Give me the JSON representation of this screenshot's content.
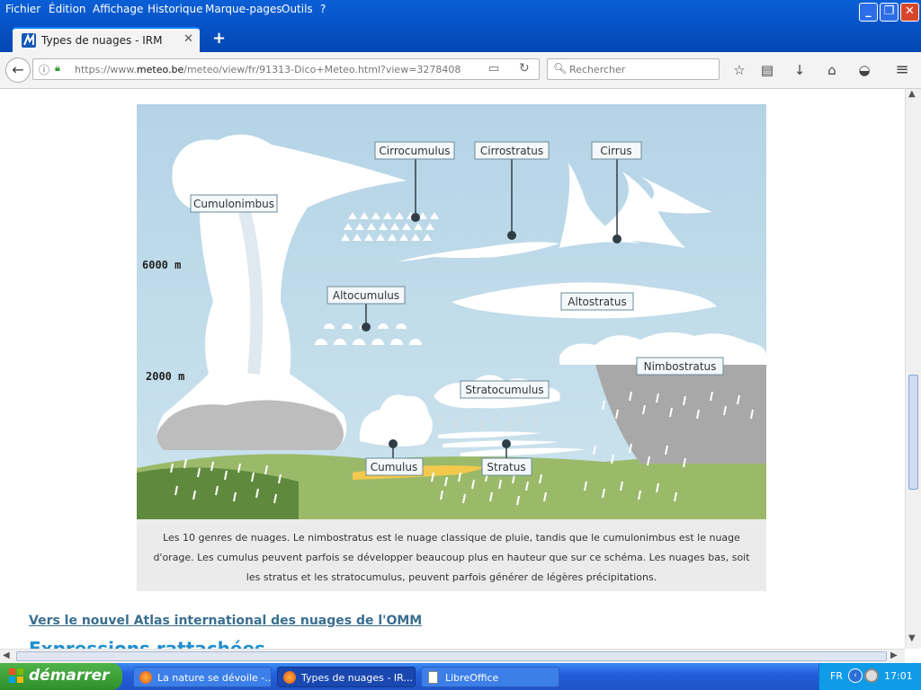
{
  "menubar": {
    "items": [
      "Fichier",
      "Édition",
      "Affichage",
      "Historique",
      "Marque-pages",
      "Outils",
      "?"
    ]
  },
  "tab": {
    "title": "Types de nuages - IRM"
  },
  "navbar": {
    "url_prefix": "https://www.",
    "url_domain": "meteo.be",
    "url_path": "/meteo/view/fr/91313-Dico+Meteo.html?view=3278408",
    "search_placeholder": "Rechercher"
  },
  "figure": {
    "labels": {
      "cirrocumulus": "Cirrocumulus",
      "cirrostratus": "Cirrostratus",
      "cirrus": "Cirrus",
      "cumulonimbus": "Cumulonimbus",
      "altocumulus": "Altocumulus",
      "altostratus": "Altostratus",
      "nimbostratus": "Nimbostratus",
      "stratocumulus": "Stratocumulus",
      "cumulus": "Cumulus",
      "stratus": "Stratus",
      "alt_6000": "6000 m",
      "alt_2000": "2000 m"
    },
    "caption_lines": [
      "Les 10 genres de nuages. Le nimbostratus est le nuage classique de pluie, tandis que le cumulonimbus est le nuage",
      "d'orage. Les cumulus peuvent parfois se développer beaucoup plus en hauteur que sur ce schéma. Les nuages bas, soit",
      "les stratus et les stratocumulus, peuvent parfois générer de légères précipitations."
    ]
  },
  "links": {
    "atlas": "Vers le nouvel Atlas international des nuages de l'OMM",
    "related": "Expressions rattachées"
  },
  "taskbar": {
    "start": "démarrer",
    "tasks": [
      "La nature se dévoile -...",
      "Types de nuages - IR...",
      "LibreOffice"
    ],
    "lang": "FR",
    "clock": "17:01"
  }
}
